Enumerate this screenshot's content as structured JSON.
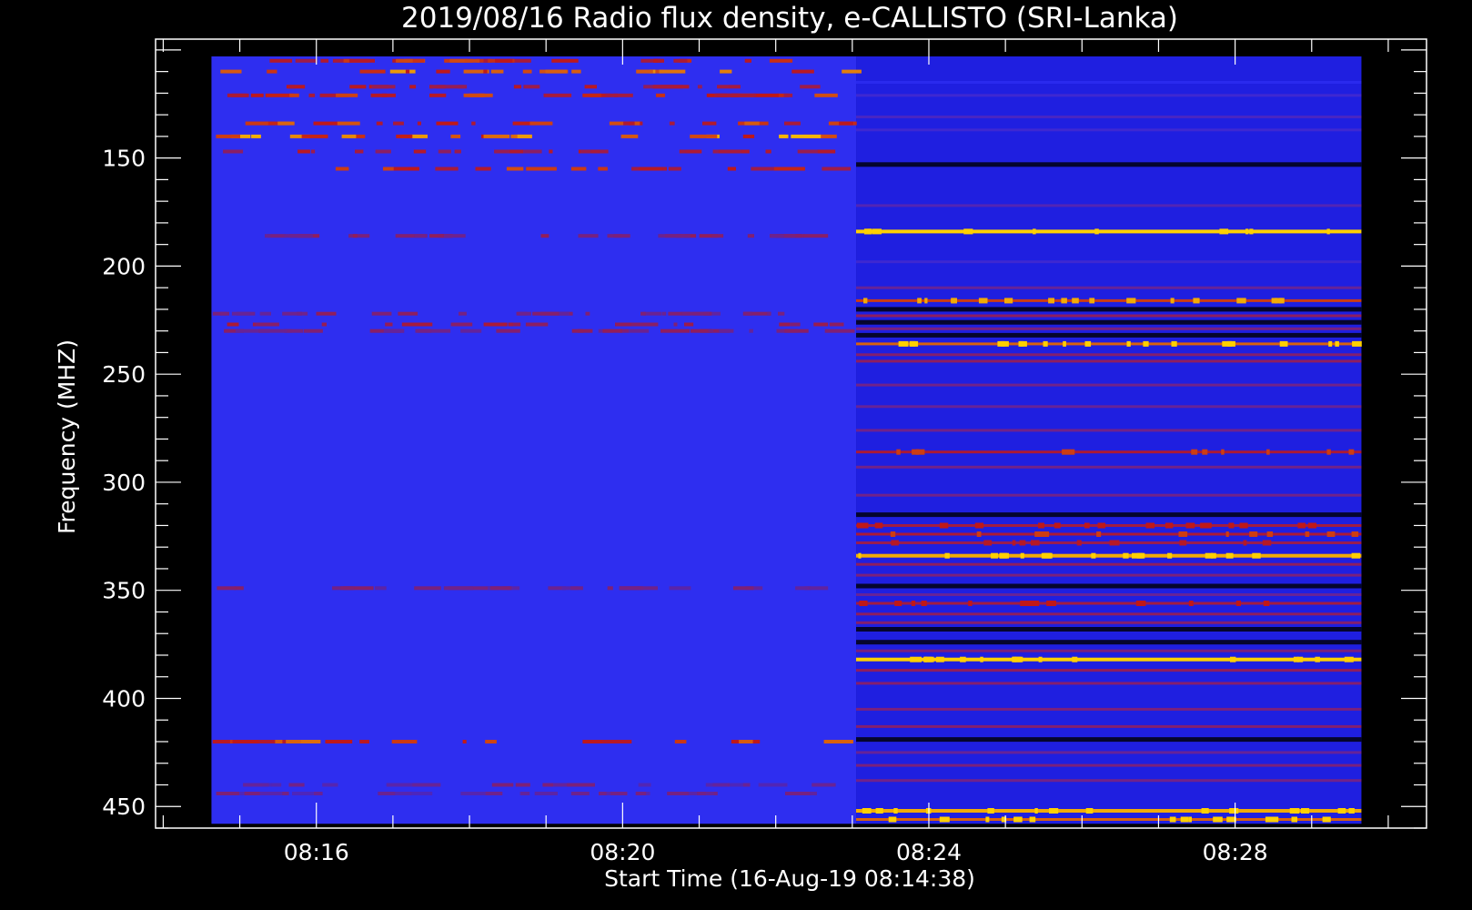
{
  "chart_data": {
    "type": "heatmap",
    "title": "2019/08/16  Radio flux density, e-CALLISTO (SRI-Lanka)",
    "xlabel": "Start Time (16-Aug-19 08:14:38)",
    "ylabel": "Frequency (MHZ)",
    "x_ticks": [
      "08:16",
      "08:20",
      "08:24",
      "08:28"
    ],
    "x_tick_minutes": [
      16,
      20,
      24,
      28
    ],
    "xlim_minutes": [
      13.9,
      30.5
    ],
    "data_x_range_minutes": [
      14.63,
      29.65
    ],
    "y_ticks": [
      150,
      200,
      250,
      300,
      350,
      400,
      450
    ],
    "ylim": [
      460,
      95
    ],
    "data_y_range": [
      103,
      458
    ],
    "segment_split_minute": 23.05,
    "colors": {
      "background": "#000000",
      "axis": "#ffffff",
      "low_intensity": "#2a2aee",
      "mid_intensity": "#c01818",
      "high_intensity": "#ffd000"
    },
    "segment1_lines": [
      {
        "freq": 105,
        "level": 0.7,
        "sparse": true
      },
      {
        "freq": 110,
        "level": 0.8,
        "sparse": true
      },
      {
        "freq": 117,
        "level": 0.6,
        "sparse": true
      },
      {
        "freq": 121,
        "level": 0.7,
        "sparse": true
      },
      {
        "freq": 134,
        "level": 0.75,
        "sparse": true
      },
      {
        "freq": 140,
        "level": 0.85,
        "sparse": true
      },
      {
        "freq": 147,
        "level": 0.6,
        "sparse": true
      },
      {
        "freq": 155,
        "level": 0.7,
        "sparse": true
      },
      {
        "freq": 186,
        "level": 0.4,
        "sparse": true
      },
      {
        "freq": 222,
        "level": 0.4,
        "sparse": true
      },
      {
        "freq": 227,
        "level": 0.55,
        "sparse": true
      },
      {
        "freq": 230,
        "level": 0.4,
        "sparse": true
      },
      {
        "freq": 349,
        "level": 0.35,
        "sparse": true
      },
      {
        "freq": 420,
        "level": 0.75,
        "sparse": true
      },
      {
        "freq": 440,
        "level": 0.3,
        "sparse": true
      },
      {
        "freq": 444,
        "level": 0.3,
        "sparse": true
      }
    ],
    "segment2_lines": [
      {
        "freq": 115,
        "level": 0.0
      },
      {
        "freq": 121,
        "level": 0.1
      },
      {
        "freq": 131,
        "level": 0.15
      },
      {
        "freq": 137,
        "level": 0.1
      },
      {
        "freq": 153,
        "level": -1
      },
      {
        "freq": 172,
        "level": 0.2
      },
      {
        "freq": 184,
        "level": 1.0
      },
      {
        "freq": 198,
        "level": 0.1
      },
      {
        "freq": 210,
        "level": 0.3
      },
      {
        "freq": 216,
        "level": 0.8
      },
      {
        "freq": 220,
        "level": -1
      },
      {
        "freq": 223,
        "level": 0.5
      },
      {
        "freq": 226,
        "level": -1
      },
      {
        "freq": 229,
        "level": 0.4
      },
      {
        "freq": 232,
        "level": -1
      },
      {
        "freq": 236,
        "level": 0.85
      },
      {
        "freq": 241,
        "level": 0.45
      },
      {
        "freq": 244,
        "level": 0.5
      },
      {
        "freq": 255,
        "level": 0.35
      },
      {
        "freq": 265,
        "level": 0.3
      },
      {
        "freq": 276,
        "level": 0.35
      },
      {
        "freq": 286,
        "level": 0.65
      },
      {
        "freq": 293,
        "level": 0.35
      },
      {
        "freq": 306,
        "level": 0.35
      },
      {
        "freq": 315,
        "level": -1
      },
      {
        "freq": 320,
        "level": 0.6
      },
      {
        "freq": 324,
        "level": 0.65
      },
      {
        "freq": 328,
        "level": 0.55
      },
      {
        "freq": 334,
        "level": 0.95
      },
      {
        "freq": 338,
        "level": 0.5
      },
      {
        "freq": 343,
        "level": 0.4
      },
      {
        "freq": 348,
        "level": -1
      },
      {
        "freq": 352,
        "level": 0.3
      },
      {
        "freq": 356,
        "level": 0.6
      },
      {
        "freq": 361,
        "level": 0.5
      },
      {
        "freq": 365,
        "level": 0.45
      },
      {
        "freq": 368,
        "level": -1
      },
      {
        "freq": 374,
        "level": -1
      },
      {
        "freq": 378,
        "level": 0.4
      },
      {
        "freq": 382,
        "level": 1.0
      },
      {
        "freq": 387,
        "level": 0.5
      },
      {
        "freq": 393,
        "level": 0.45
      },
      {
        "freq": 405,
        "level": 0.4
      },
      {
        "freq": 413,
        "level": 0.45
      },
      {
        "freq": 419,
        "level": -1
      },
      {
        "freq": 425,
        "level": 0.3
      },
      {
        "freq": 431,
        "level": 0.4
      },
      {
        "freq": 438,
        "level": 0.35
      },
      {
        "freq": 452,
        "level": 0.95
      },
      {
        "freq": 456,
        "level": 0.85
      }
    ]
  }
}
